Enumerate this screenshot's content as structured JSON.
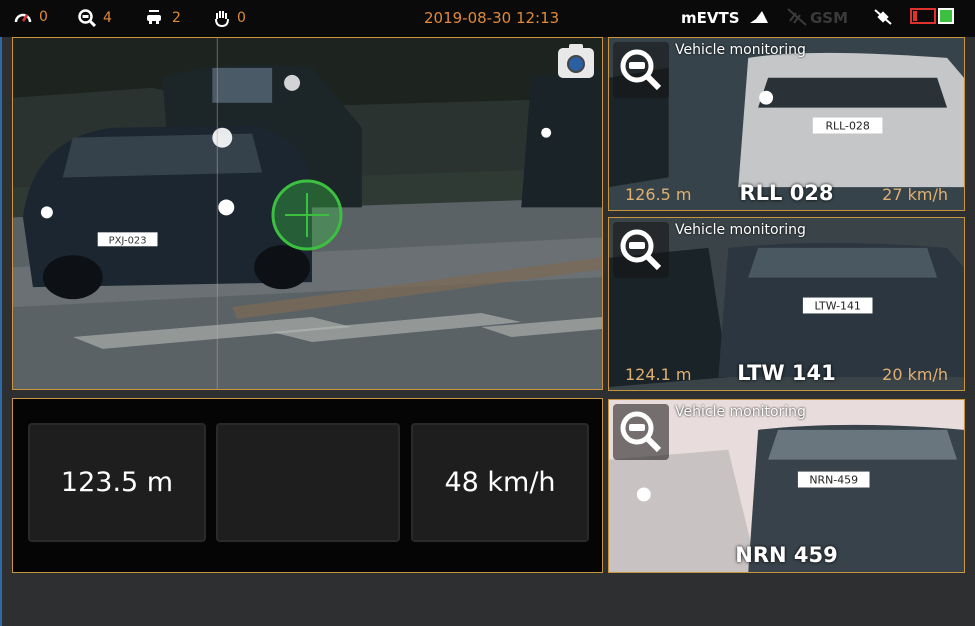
{
  "status_bar": {
    "speed_violations": "0",
    "monitor_count": "4",
    "queue_count": "2",
    "manual_count": "0",
    "datetime": "2019-08-30 12:13",
    "app_name": "mEVTS",
    "gsm_label": "GSM",
    "battery_level_fraction": 0.2,
    "colors": {
      "accent": "#e08a3a",
      "alert": "#e03030",
      "ok": "#3cc040"
    }
  },
  "main_view": {
    "capture_icon": "camera-icon",
    "target_icon": "crosshair-icon"
  },
  "readouts": {
    "distance": "123.5 m",
    "middle": "",
    "speed": "48 km/h"
  },
  "tiles": [
    {
      "label": "Vehicle monitoring",
      "distance": "126.5 m",
      "plate": "RLL 028",
      "speed": "27 km/h",
      "icon": "zoom-vehicle-icon"
    },
    {
      "label": "Vehicle monitoring",
      "distance": "124.1 m",
      "plate": "LTW 141",
      "speed": "20 km/h",
      "icon": "zoom-vehicle-icon"
    },
    {
      "label": "Vehicle monitoring",
      "distance": "",
      "plate": "NRN 459",
      "speed": "",
      "icon": "zoom-vehicle-icon"
    }
  ]
}
